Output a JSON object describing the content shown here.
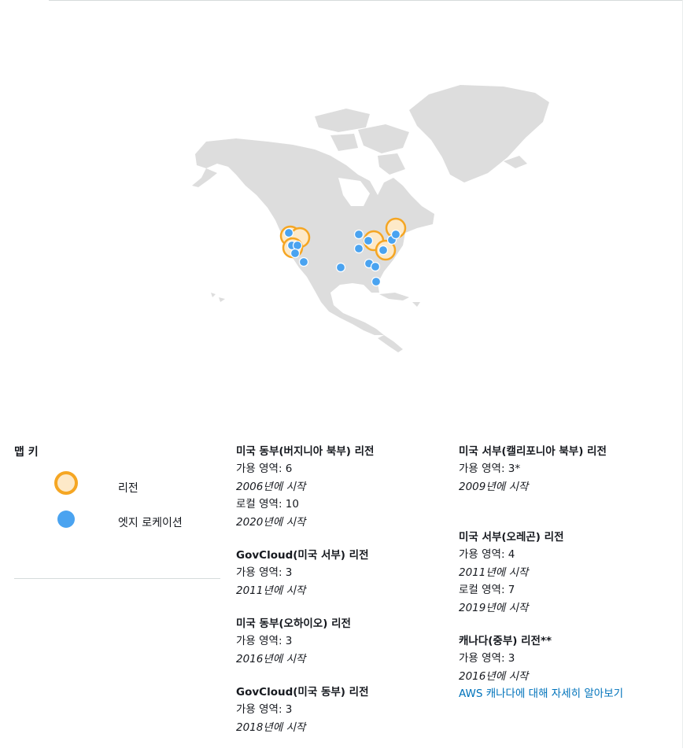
{
  "legend": {
    "title": "맵 키",
    "region_label": "리전",
    "edge_label": "엣지 로케이션"
  },
  "colors": {
    "region_ring": "#f5a623",
    "region_fill": "#fde9c8",
    "edge": "#4aa3f0",
    "land": "#dddddd"
  },
  "regions_left": [
    {
      "title": "미국 동부(버지니아 북부) 리전",
      "az": "가용 영역: 6",
      "az_since": "2006년에 시작",
      "local": "로컬 영역: 10",
      "local_since": "2020년에 시작"
    },
    {
      "title": "GovCloud(미국 서부) 리전",
      "az": "가용 영역: 3",
      "az_since": "2011년에 시작"
    },
    {
      "title": "미국 동부(오하이오) 리전",
      "az": "가용 영역: 3",
      "az_since": "2016년에 시작"
    },
    {
      "title": "GovCloud(미국 동부) 리전",
      "az": "가용 영역: 3",
      "az_since": "2018년에 시작"
    }
  ],
  "regions_right": [
    {
      "title": "미국 서부(캘리포니아 북부) 리전",
      "az": "가용 영역: 3*",
      "az_since": "2009년에 시작"
    },
    {
      "title": "미국 서부(오레곤) 리전",
      "az": "가용 영역: 4",
      "az_since": "2011년에 시작",
      "local": "로컬 영역: 7",
      "local_since": "2019년에 시작"
    },
    {
      "title": "캐나다(중부) 리전**",
      "az": "가용 영역: 3",
      "az_since": "2016년에 시작",
      "link": "AWS 캐나다에 대해 자세히 알아보기"
    }
  ]
}
